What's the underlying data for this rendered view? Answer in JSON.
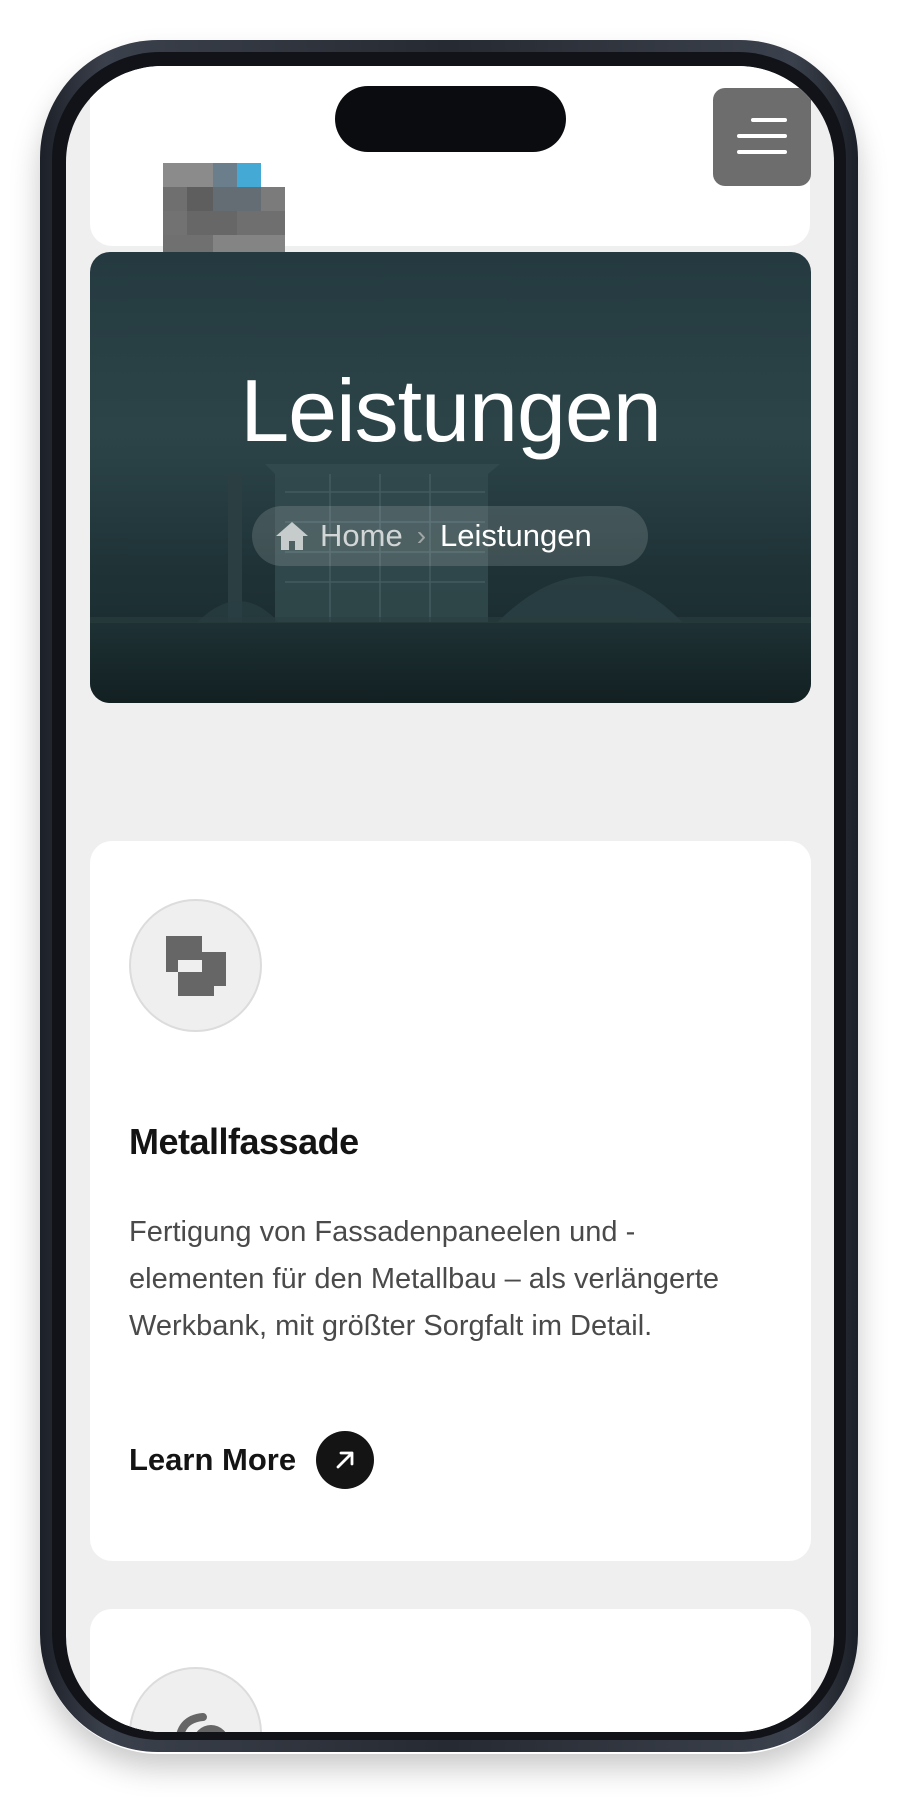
{
  "page": {
    "title": "Leistungen"
  },
  "header": {
    "logo_icon": "company-logo",
    "menu_icon": "hamburger-menu-icon"
  },
  "hero": {
    "title": "Leistungen",
    "breadcrumb": {
      "home_icon": "home-icon",
      "home_label": "Home",
      "separator_icon": "chevron-right-icon",
      "separator": "›",
      "current_label": "Leistungen"
    }
  },
  "services": [
    {
      "icon": "facade-panels-icon",
      "title": "Metallfassade",
      "description": "Fertigung von Fassadenpaneelen und -elementen für den Metallbau – als verlängerte Werkbank, mit größter Sorgfalt im Detail.",
      "link_label": "Learn More",
      "link_icon": "arrow-up-right-icon"
    },
    {
      "icon": "service-icon-partial"
    }
  ],
  "colors": {
    "accent_dark": "#141414",
    "page_bg": "#efefef",
    "menu_button": "#6d6d6d",
    "hero_overlay": "#243a40"
  }
}
